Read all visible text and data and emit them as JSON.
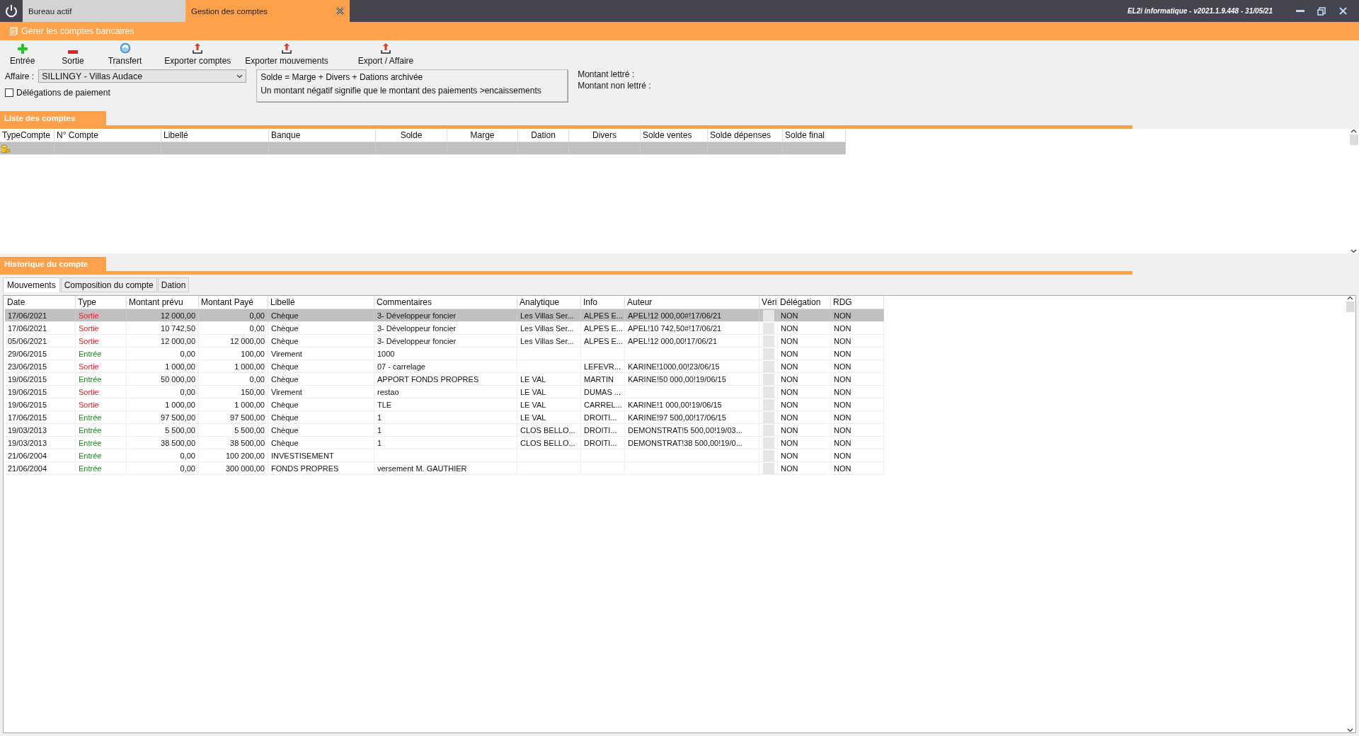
{
  "window": {
    "tabs": [
      {
        "label": "Bureau actif",
        "selected": false
      },
      {
        "label": "Gestion des comptes",
        "selected": true
      }
    ],
    "version": "EL2i informatique - v2021.1.9.448 - 31/05/21"
  },
  "header": {
    "title": "Gérer les comptes bancaires"
  },
  "toolbar": [
    {
      "label": "Entrée",
      "kind": "plus"
    },
    {
      "label": "Sortie",
      "kind": "minus"
    },
    {
      "label": "Transfert",
      "kind": "refresh"
    },
    {
      "label": "Exporter comptes",
      "kind": "export"
    },
    {
      "label": "Exporter mouvements",
      "kind": "export"
    },
    {
      "label": "Export / Affaire",
      "kind": "export"
    }
  ],
  "filters": {
    "affaire_label": "Affaire :",
    "affaire_value": "SILLINGY - Villas Audace",
    "delegations": {
      "label": "Délégations de paiement",
      "checked": false
    }
  },
  "info": [
    "Solde = Marge + Divers + Dations archivée",
    "Un montant négatif signifie que le montant des paiements >encaissements"
  ],
  "amounts": [
    "Montant lettré :",
    "Montant non lettré :"
  ],
  "accounts": {
    "title": "Liste des comptes",
    "columns": [
      "TypeCompte",
      "N° Compte",
      "Libellé",
      "Banque",
      "Solde",
      "Marge",
      "Dation",
      "Divers",
      "Solde ventes",
      "Solde dépenses",
      "Solde final"
    ],
    "rows": [
      {
        "selected": true
      }
    ]
  },
  "history": {
    "title": "Historique du compte",
    "tabs": [
      {
        "label": "Mouvements",
        "selected": true
      },
      {
        "label": "Composition du compte",
        "selected": false
      },
      {
        "label": "Dation",
        "selected": false
      }
    ],
    "columns": [
      "Date",
      "Type",
      "Montant prévu",
      "Montant Payé",
      "Libellé",
      "Commentaires",
      "Analytique",
      "Info",
      "Auteur",
      "Véri",
      "Délégation",
      "RDG"
    ],
    "rows": [
      {
        "selected": true,
        "kind": "out",
        "verified": false,
        "cells": [
          "17/06/2021",
          "Sortie",
          "12 000,00",
          "0,00",
          "Chèque",
          "3- Développeur foncier",
          "Les Villas Ser...",
          "ALPES E...",
          "APEL!12 000,00#!17/06/21",
          "",
          "NON",
          "NON"
        ]
      },
      {
        "selected": false,
        "kind": "out",
        "verified": false,
        "cells": [
          "17/06/2021",
          "Sortie",
          "10 742,50",
          "0,00",
          "Chèque",
          "3- Développeur foncier",
          "Les Villas Ser...",
          "ALPES E...",
          "APEL!10 742,50#!17/06/21",
          "",
          "NON",
          "NON"
        ]
      },
      {
        "selected": false,
        "kind": "out",
        "verified": false,
        "cells": [
          "05/06/2021",
          "Sortie",
          "12 000,00",
          "12 000,00",
          "Chèque",
          "3- Développeur foncier",
          "Les Villas Ser...",
          "ALPES E...",
          "APEL!12 000,00!17/06/21",
          "",
          "NON",
          "NON"
        ]
      },
      {
        "selected": false,
        "kind": "in",
        "verified": false,
        "cells": [
          "29/06/2015",
          "Entrée",
          "0,00",
          "100,00",
          "Virement",
          "1000",
          "",
          "",
          "",
          "",
          "NON",
          "NON"
        ]
      },
      {
        "selected": false,
        "kind": "out",
        "verified": false,
        "cells": [
          "23/06/2015",
          "Sortie",
          "1 000,00",
          "1 000,00",
          "Chèque",
          "07 - carrelage",
          "",
          "LEFEVR...",
          "KARINE!1000,00!23/06/15",
          "",
          "NON",
          "NON"
        ]
      },
      {
        "selected": false,
        "kind": "in",
        "verified": false,
        "cells": [
          "19/06/2015",
          "Entrée",
          "50 000,00",
          "0,00",
          "Chèque",
          "APPORT FONDS PROPRES",
          "LE VAL",
          "MARTIN",
          "KARINE!50 000,00!19/06/15",
          "",
          "NON",
          "NON"
        ]
      },
      {
        "selected": false,
        "kind": "out",
        "verified": false,
        "cells": [
          "19/06/2015",
          "Sortie",
          "0,00",
          "150,00",
          "Virement",
          "restao",
          "LE VAL",
          "DUMAS ...",
          "",
          "",
          "NON",
          "NON"
        ]
      },
      {
        "selected": false,
        "kind": "out",
        "verified": false,
        "cells": [
          "19/06/2015",
          "Sortie",
          "1 000,00",
          "1 000,00",
          "Chèque",
          "TLE",
          "LE VAL",
          "CARREL...",
          "KARINE!1 000,00!19/06/15",
          "",
          "NON",
          "NON"
        ]
      },
      {
        "selected": false,
        "kind": "in",
        "verified": false,
        "cells": [
          "17/06/2015",
          "Entrée",
          "97 500,00",
          "97 500,00",
          "Chèque",
          "1",
          "LE VAL",
          "DROITI...",
          "KARINE!97 500,00!17/06/15",
          "",
          "NON",
          "NON"
        ]
      },
      {
        "selected": false,
        "kind": "in",
        "verified": false,
        "cells": [
          "19/03/2013",
          "Entrée",
          "5 500,00",
          "5 500,00",
          "Chèque",
          "1",
          "CLOS BELLO...",
          "DROITI...",
          "DEMONSTRAT!5 500,00!19/03...",
          "",
          "NON",
          "NON"
        ]
      },
      {
        "selected": false,
        "kind": "in",
        "verified": false,
        "cells": [
          "19/03/2013",
          "Entrée",
          "38 500,00",
          "38 500,00",
          "Chèque",
          "1",
          "CLOS BELLO...",
          "DROITI...",
          "DEMONSTRAT!38 500,00!19/0...",
          "",
          "NON",
          "NON"
        ]
      },
      {
        "selected": false,
        "kind": "in",
        "verified": false,
        "cells": [
          "21/06/2004",
          "Entrée",
          "0,00",
          "100 200,00",
          "INVESTISEMENT",
          "",
          "",
          "",
          "",
          "",
          "NON",
          "NON"
        ]
      },
      {
        "selected": false,
        "kind": "in",
        "verified": false,
        "cells": [
          "21/06/2004",
          "Entrée",
          "0,00",
          "300 000,00",
          "FONDS PROPRES",
          "versement M. GAUTHIER",
          "",
          "",
          "",
          "",
          "NON",
          "NON"
        ]
      }
    ]
  }
}
